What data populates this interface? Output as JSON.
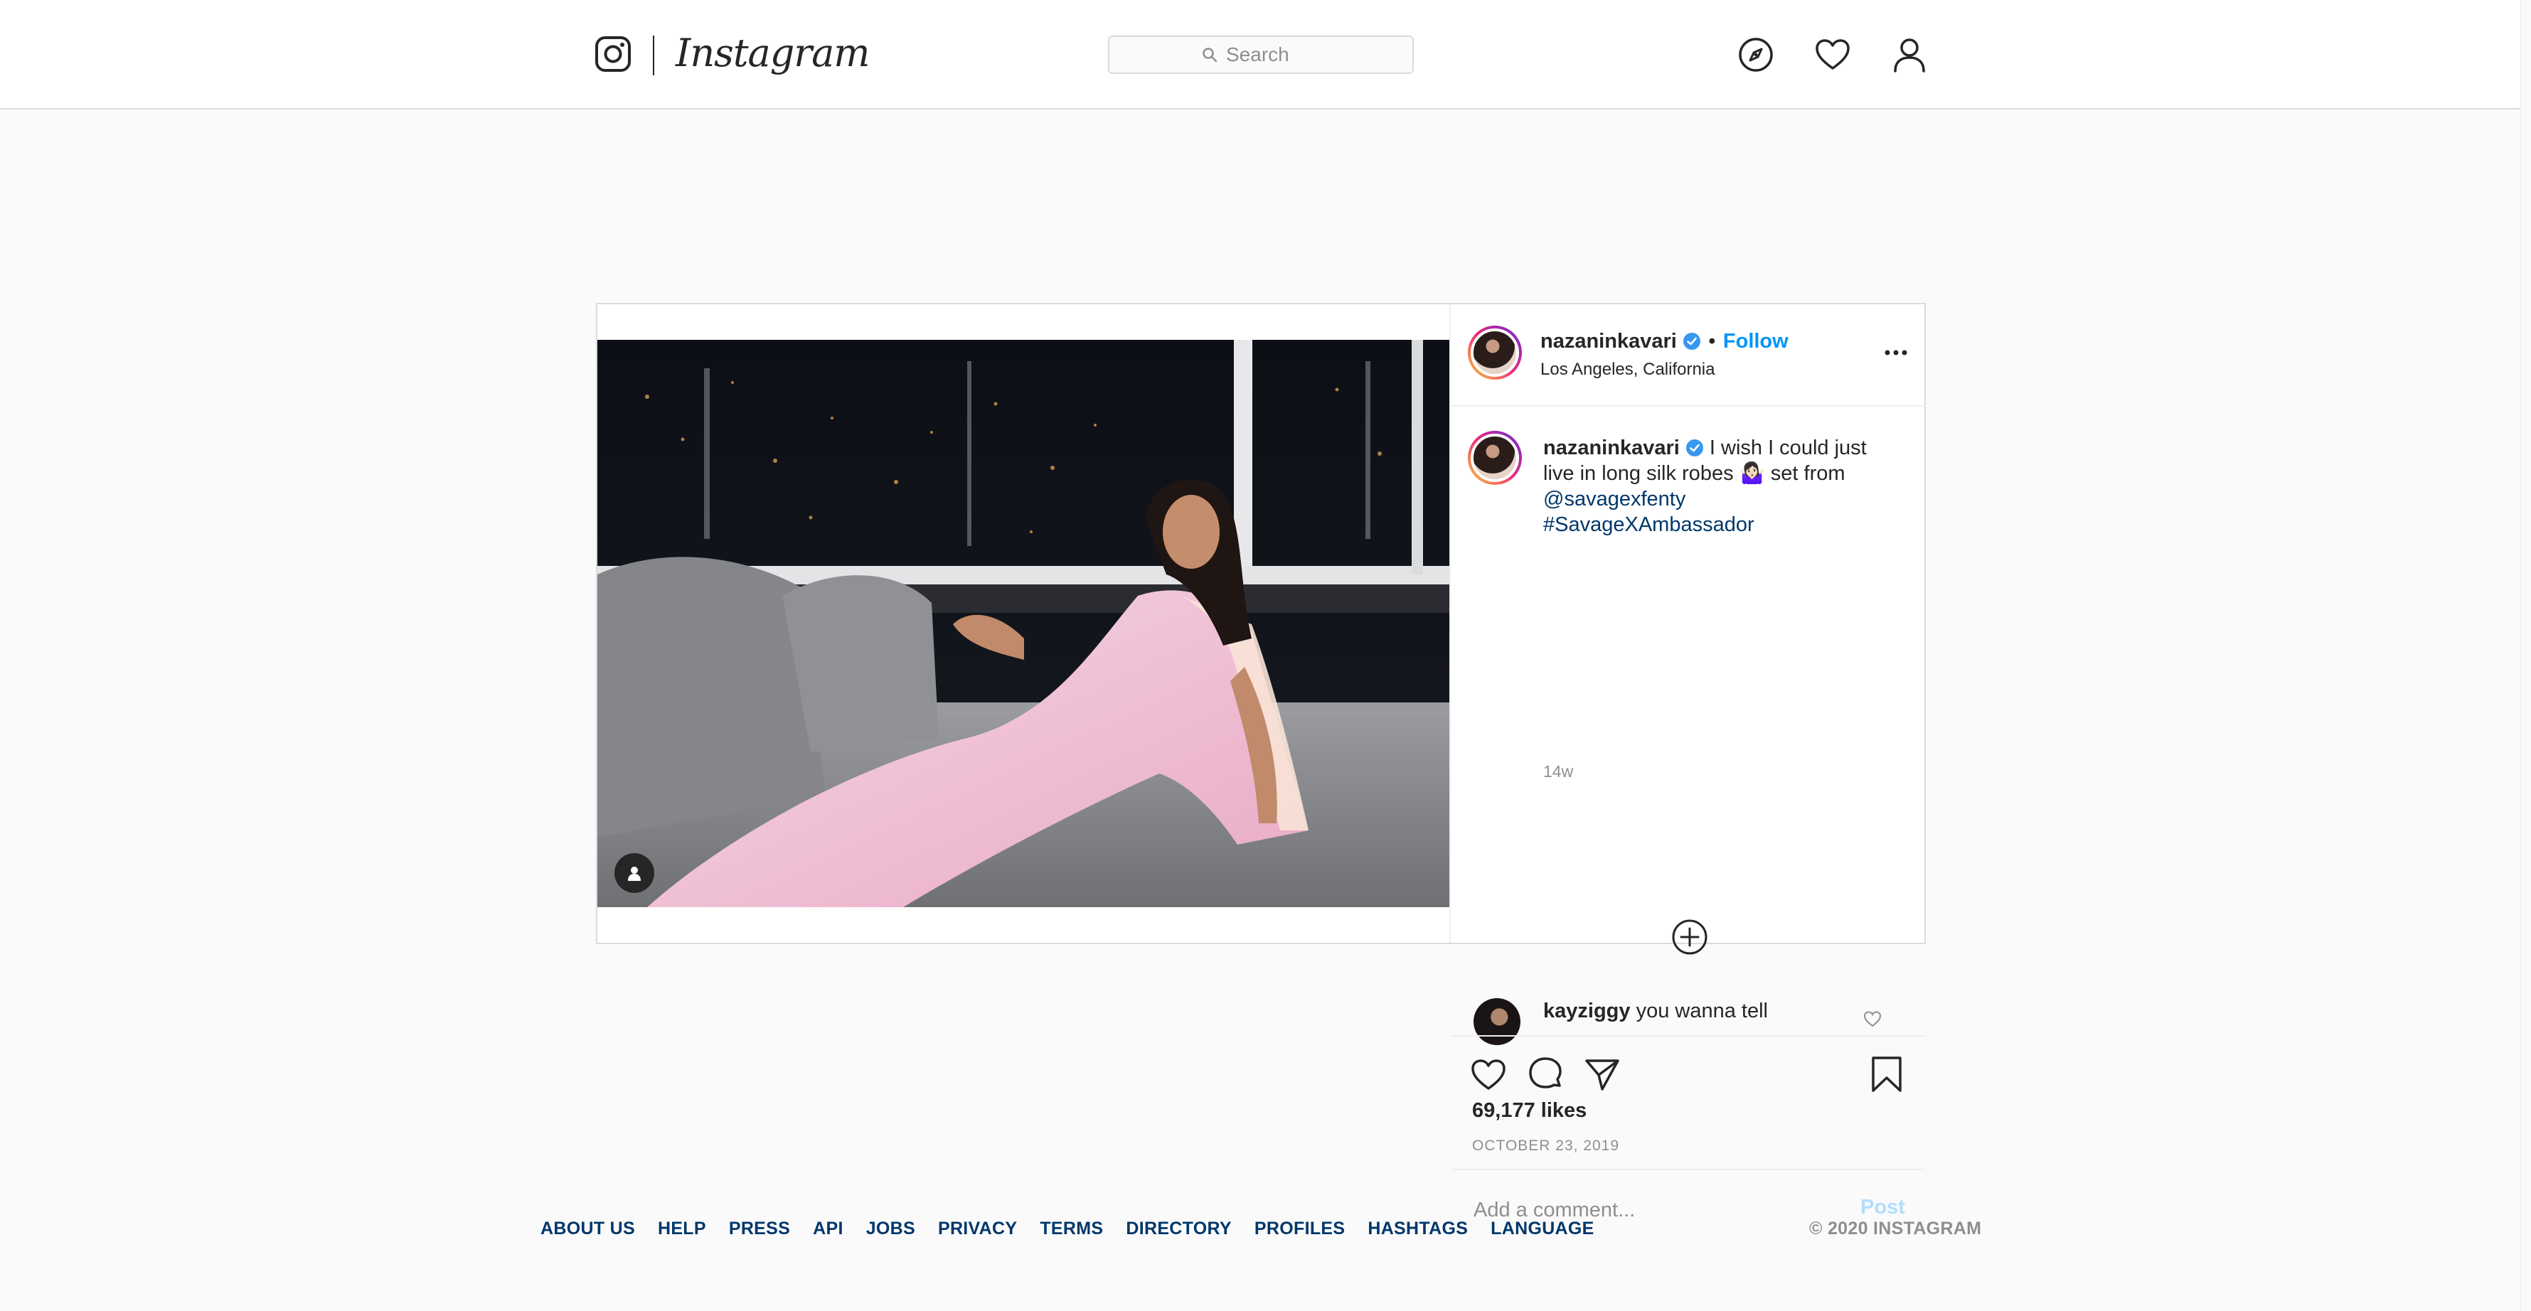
{
  "header": {
    "brand": "Instagram",
    "search": {
      "placeholder": "Search"
    },
    "nav_icons": [
      "explore-compass-icon",
      "activity-heart-icon",
      "profile-person-icon"
    ]
  },
  "post": {
    "author": {
      "username": "nazaninkavari",
      "verified": true,
      "location": "Los Angeles, California",
      "separator": "•",
      "follow_label": "Follow"
    },
    "caption": {
      "username": "nazaninkavari",
      "text": " I wish I could just live in long silk robes ",
      "emoji": "🤷🏻‍♀️",
      "text_after": " set from ",
      "mention": "@savagexfenty",
      "hashtag": "#SavageXAmbassador",
      "time_ago": "14w"
    },
    "comments": [
      {
        "username": "kayziggy",
        "text": "you wanna tell"
      }
    ],
    "likes": "69,177 likes",
    "date": "OCTOBER 23, 2019",
    "add_comment": {
      "placeholder": "Add a comment...",
      "post_label": "Post"
    }
  },
  "footer": {
    "links": [
      "ABOUT US",
      "HELP",
      "PRESS",
      "API",
      "JOBS",
      "PRIVACY",
      "TERMS",
      "DIRECTORY",
      "PROFILES",
      "HASHTAGS",
      "LANGUAGE"
    ],
    "copyright": "© 2020 INSTAGRAM"
  },
  "colors": {
    "accent": "#0095f6",
    "link": "#00376b",
    "muted": "#8e8e8e",
    "border": "#dbdbdb",
    "background": "#fafafa"
  }
}
